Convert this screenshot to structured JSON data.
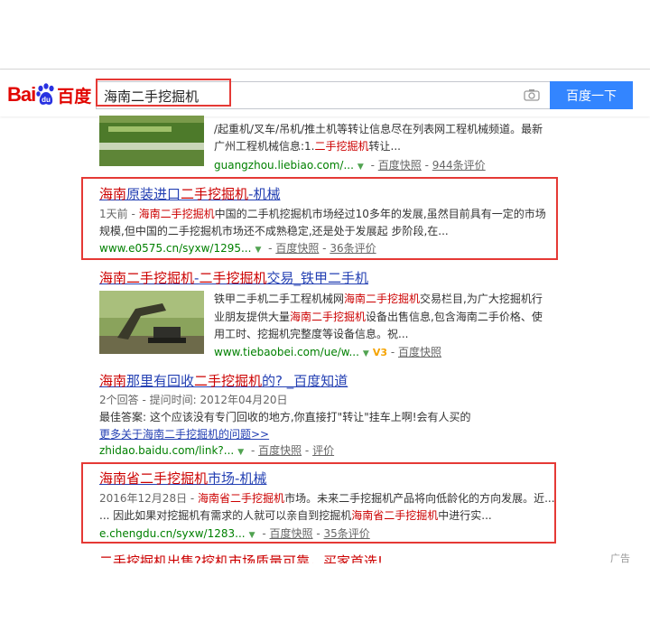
{
  "header": {
    "logo_bai": "Bai",
    "logo_du": "du",
    "logo_cn": "百度",
    "query": "海南二手挖掘机",
    "search_button": "百度一下",
    "camera_icon": "camera-icon"
  },
  "result1": {
    "snippet_line1": "/起重机/叉车/吊机/推土机等转让信息尽在列表网工程机械频道。最新",
    "snippet_line2_pre": "广州工程机械信息:1.",
    "snippet_line2_em": "二手挖掘机",
    "snippet_line2_post": "转让...",
    "url": "guangzhou.liebiao.com/...",
    "snapshot": "百度快照",
    "reviews": "944条评价"
  },
  "result2": {
    "title_em": "海南",
    "title_mid": "原装进口",
    "title_em2": "二手挖掘机",
    "title_post": "-机械",
    "line1_gray": "1天前 - ",
    "line1_em": "海南二手挖掘机",
    "line1_post": "中国的二手机挖掘机市场经过10多年的发展,虽然目前具有一定的市场",
    "line2": "规模,但中国的二手挖掘机市场还不成熟稳定,还是处于发展起 步阶段,在...",
    "url": "www.e0575.cn/syxw/1295...",
    "snapshot": "百度快照",
    "reviews": "36条评价"
  },
  "result3": {
    "title_em": "海南二手挖掘机",
    "title_mid": "-",
    "title_em2": "二手挖掘机",
    "title_post": "交易_铁甲二手机",
    "line1_pre": "铁甲二手机二手工程机械网",
    "line1_em": "海南二手挖掘机",
    "line1_post": "交易栏目,为广大挖掘机行",
    "line2_pre": "业朋友提供大量",
    "line2_em": "海南二手挖掘机",
    "line2_post": "设备出售信息,包含海南二手价格、使",
    "line3": "用工时、挖掘机完整度等设备信息。祝...",
    "url": "www.tiebaobei.com/ue/w...",
    "badge": "V3",
    "snapshot": "百度快照"
  },
  "result4": {
    "title_em": "海南",
    "title_mid": "那里有回收",
    "title_em2": "二手挖掘机",
    "title_post": "的? _百度知道",
    "line1": "2个回答 - 提问时间: 2012年04月20日",
    "line2": "最佳答案: 这个应该没有专门回收的地方,你直接打\"转让\"挂车上啊!会有人买的",
    "more": "更多关于海南二手挖掘机的问题>>",
    "url": "zhidao.baidu.com/link?...",
    "snapshot": "百度快照",
    "reviews": "评价"
  },
  "result5": {
    "title_em": "海南省二手挖掘机",
    "title_post": "市场-机械",
    "line1_gray": "2016年12月28日 - ",
    "line1_em": "海南省二手挖掘机",
    "line1_post": "市场。未来二手挖掘机产品将向低龄化的方向发展。近...",
    "line2_pre": "... 因此如果对挖掘机有需求的人就可以亲自到挖掘机",
    "line2_em": "海南省二手挖掘机",
    "line2_post": "中进行实...",
    "url": "e.chengdu.cn/syxw/1283...",
    "snapshot": "百度快照",
    "reviews": "35条评价"
  },
  "result6": {
    "title_partial": "二手挖掘机出售?挖机市场质量可靠，买家首选!",
    "ad_label": "广告"
  }
}
